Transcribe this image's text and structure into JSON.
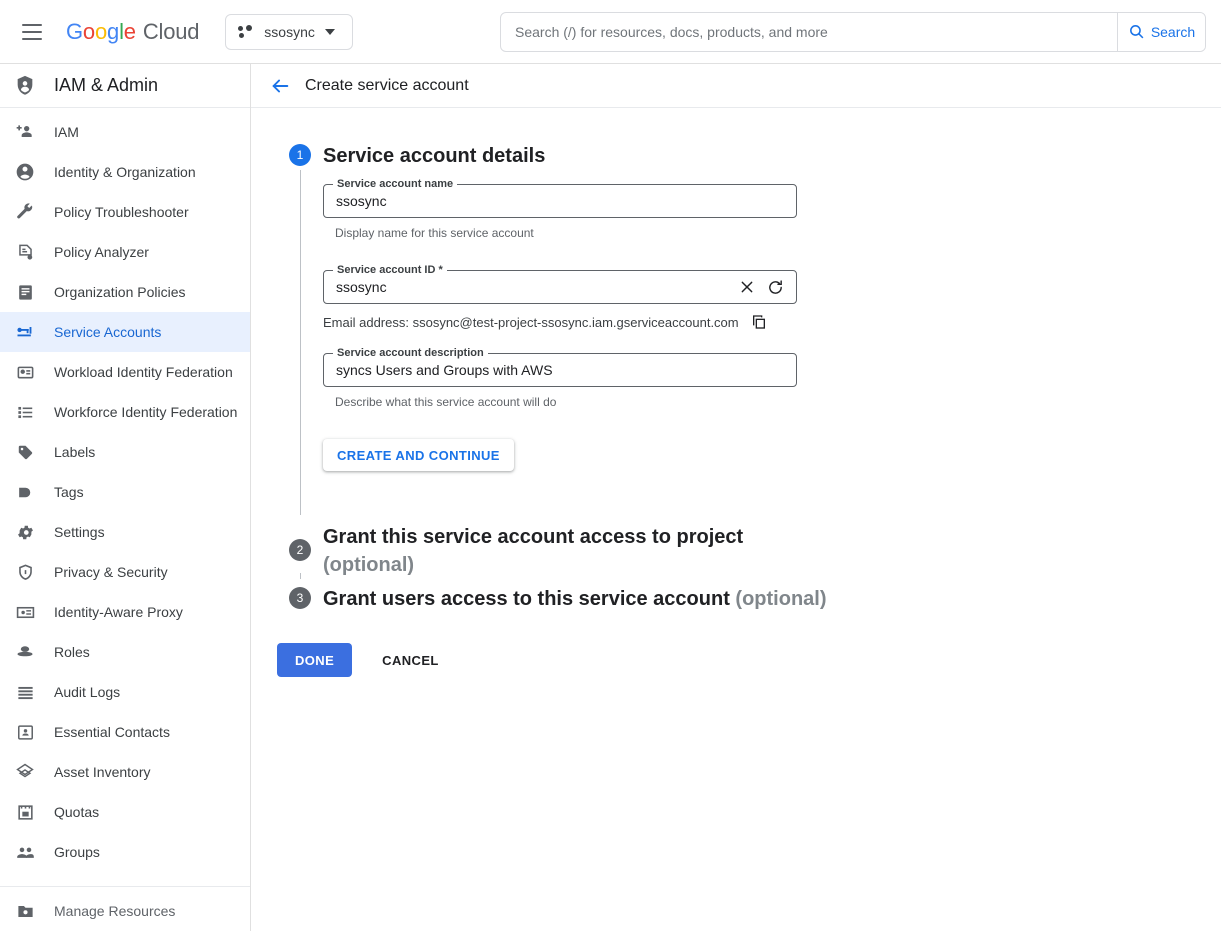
{
  "topbar": {
    "menu_icon": "hamburger-menu-icon",
    "brand": {
      "g1": "G",
      "o1": "o",
      "o2": "o",
      "g2": "g",
      "l": "l",
      "e": "e",
      "cloud": "Cloud"
    },
    "project_selector": {
      "icon": "project-dots-icon",
      "name": "ssosync",
      "caret": "chevron-down-icon"
    },
    "search": {
      "placeholder": "Search (/) for resources, docs, products, and more",
      "value": "",
      "button_label": "Search",
      "icon": "search-icon"
    }
  },
  "sidebar": {
    "header": {
      "icon": "shield-person-icon",
      "title": "IAM & Admin"
    },
    "items": [
      {
        "label": "IAM",
        "icon": "person-add-icon",
        "active": false
      },
      {
        "label": "Identity & Organization",
        "icon": "account-circle-icon",
        "active": false
      },
      {
        "label": "Policy Troubleshooter",
        "icon": "wrench-icon",
        "active": false
      },
      {
        "label": "Policy Analyzer",
        "icon": "policy-document-icon",
        "active": false
      },
      {
        "label": "Organization Policies",
        "icon": "list-document-icon",
        "active": false
      },
      {
        "label": "Service Accounts",
        "icon": "key-badge-icon",
        "active": true
      },
      {
        "label": "Workload Identity Federation",
        "icon": "id-card-icon",
        "active": false
      },
      {
        "label": "Workforce Identity Federation",
        "icon": "list-bullets-icon",
        "active": false
      },
      {
        "label": "Labels",
        "icon": "tag-icon",
        "active": false
      },
      {
        "label": "Tags",
        "icon": "tags-arrow-icon",
        "active": false
      },
      {
        "label": "Settings",
        "icon": "gear-icon",
        "active": false
      },
      {
        "label": "Privacy & Security",
        "icon": "shield-icon",
        "active": false
      },
      {
        "label": "Identity-Aware Proxy",
        "icon": "proxy-icon",
        "active": false
      },
      {
        "label": "Roles",
        "icon": "roles-hat-icon",
        "active": false
      },
      {
        "label": "Audit Logs",
        "icon": "audit-lines-icon",
        "active": false
      },
      {
        "label": "Essential Contacts",
        "icon": "contact-card-icon",
        "active": false
      },
      {
        "label": "Asset Inventory",
        "icon": "asset-diamond-icon",
        "active": false
      },
      {
        "label": "Quotas",
        "icon": "quotas-icon",
        "active": false
      },
      {
        "label": "Groups",
        "icon": "groups-people-icon",
        "active": false
      }
    ],
    "footer": [
      {
        "label": "Manage Resources",
        "icon": "manage-resources-folder-icon"
      }
    ]
  },
  "main": {
    "back_icon": "arrow-back-icon",
    "title": "Create service account",
    "steps": [
      {
        "number": "1",
        "title": "Service account details",
        "optional": "",
        "current": true
      },
      {
        "number": "2",
        "title": "Grant this service account access to project",
        "optional": "(optional)",
        "current": false
      },
      {
        "number": "3",
        "title": "Grant users access to this service account",
        "optional": "(optional)",
        "current": false
      }
    ],
    "form": {
      "name_field": {
        "label": "Service account name",
        "value": "ssosync",
        "placeholder": "",
        "helper": "Display name for this service account"
      },
      "id_field": {
        "label": "Service account ID *",
        "value": "ssosync",
        "placeholder": "",
        "clear_icon": "close-icon",
        "refresh_icon": "refresh-icon"
      },
      "email_line": {
        "text": "Email address: ssosync@test-project-ssosync.iam.gserviceaccount.com",
        "copy_icon": "copy-icon"
      },
      "description_field": {
        "label": "Service account description",
        "value": "syncs Users and Groups with AWS",
        "placeholder": "",
        "helper": "Describe what this service account will do"
      },
      "create_continue_label": "CREATE AND CONTINUE"
    },
    "footer": {
      "done_label": "DONE",
      "cancel_label": "CANCEL"
    }
  },
  "colors": {
    "accent_blue": "#1a73e8",
    "primary_button": "#3b6fe0",
    "sidebar_active_bg": "#e8f0fe",
    "sidebar_active_fg": "#1967d2",
    "step_inactive": "#5f6368",
    "text_primary": "#202124",
    "text_secondary": "#5f6368"
  }
}
